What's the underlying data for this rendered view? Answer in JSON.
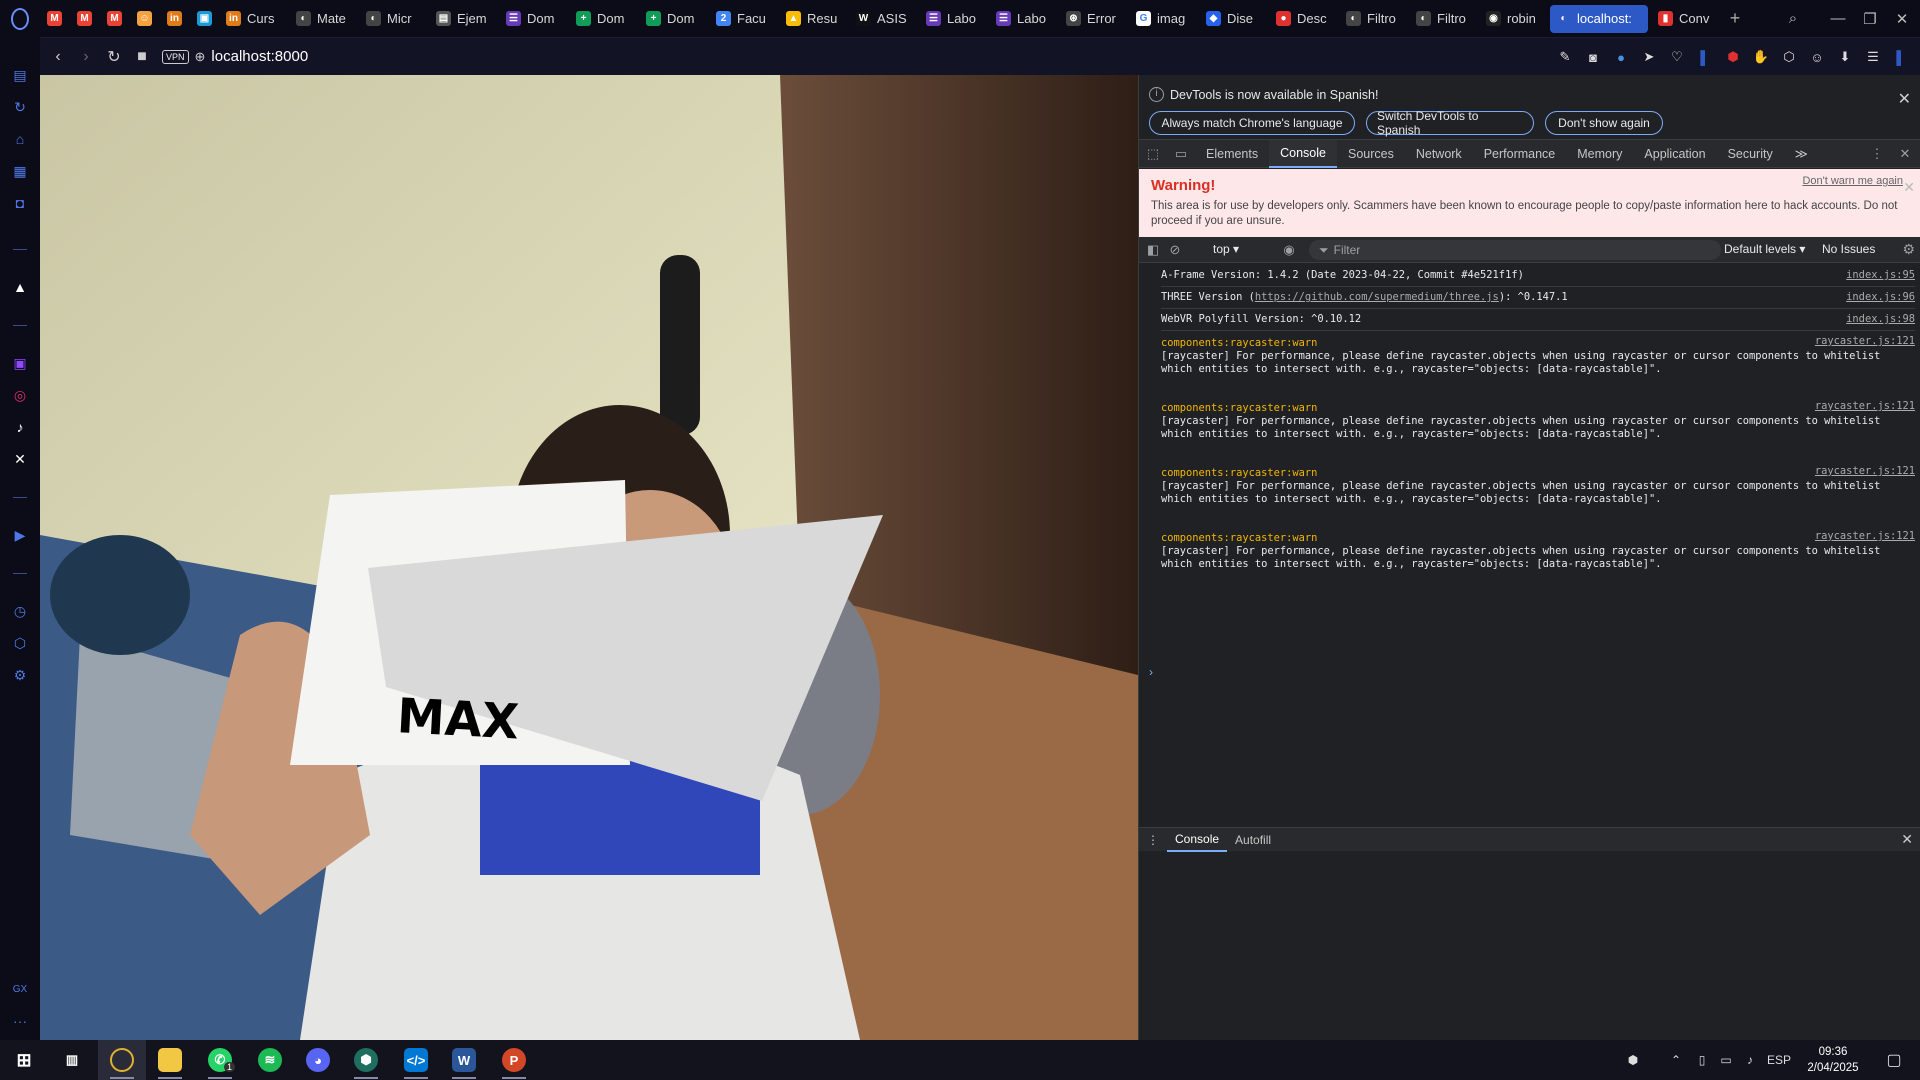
{
  "browser": {
    "tabs": [
      {
        "label": "",
        "icon": "gmail-icon",
        "color": "#ea4335",
        "glyph": "M"
      },
      {
        "label": "",
        "icon": "gmail-icon",
        "color": "#ea4335",
        "glyph": "M"
      },
      {
        "label": "",
        "icon": "gmail-icon",
        "color": "#ea4335",
        "glyph": "M"
      },
      {
        "label": "",
        "icon": "profile-icon",
        "color": "#f4a340",
        "glyph": "☺"
      },
      {
        "label": "",
        "icon": "linkedin-icon",
        "color": "#e07b1a",
        "glyph": "in"
      },
      {
        "label": "",
        "icon": "contacts-icon",
        "color": "#1a9ad6",
        "glyph": "▣"
      },
      {
        "label": "Curs",
        "icon": "linkedin-icon",
        "color": "#e07b1a",
        "glyph": "in"
      },
      {
        "label": "Mate",
        "icon": "globe-icon",
        "color": "#444",
        "glyph": "◐"
      },
      {
        "label": "Micr",
        "icon": "globe-icon",
        "color": "#444",
        "glyph": "◐"
      },
      {
        "label": "Ejem",
        "icon": "document-icon",
        "color": "#555",
        "glyph": "▤"
      },
      {
        "label": "Dom",
        "icon": "forms-icon",
        "color": "#673ab7",
        "glyph": "☰"
      },
      {
        "label": "Dom",
        "icon": "sheets-icon",
        "color": "#0f9d58",
        "glyph": "+"
      },
      {
        "label": "Dom",
        "icon": "sheets-icon",
        "color": "#0f9d58",
        "glyph": "+"
      },
      {
        "label": "Facu",
        "icon": "calendar-icon",
        "color": "#4285f4",
        "glyph": "2"
      },
      {
        "label": "Resu",
        "icon": "drive-icon",
        "color": "#fbbc05",
        "glyph": "▲"
      },
      {
        "label": "ASIS",
        "icon": "wix-icon",
        "color": "#111",
        "glyph": "W"
      },
      {
        "label": "Labo",
        "icon": "forms-icon",
        "color": "#673ab7",
        "glyph": "☰"
      },
      {
        "label": "Labo",
        "icon": "forms-icon",
        "color": "#673ab7",
        "glyph": "☰"
      },
      {
        "label": "Error",
        "icon": "chatgpt-icon",
        "color": "#444",
        "glyph": "⊛"
      },
      {
        "label": "imag",
        "icon": "google-icon",
        "color": "#fff",
        "glyph": "G"
      },
      {
        "label": "Dise",
        "icon": "design-icon",
        "color": "#2563eb",
        "glyph": "◆"
      },
      {
        "label": "Desc",
        "icon": "opera-red-icon",
        "color": "#e03131",
        "glyph": "●"
      },
      {
        "label": "Filtro",
        "icon": "globe-icon",
        "color": "#444",
        "glyph": "◐"
      },
      {
        "label": "Filtro",
        "icon": "globe-icon",
        "color": "#444",
        "glyph": "◐"
      },
      {
        "label": "robin",
        "icon": "github-icon",
        "color": "#222",
        "glyph": "◉"
      },
      {
        "label": "localhost:",
        "icon": "globe-icon",
        "color": "#2d59c6",
        "glyph": "◐",
        "active": true
      },
      {
        "label": "Conv",
        "icon": "pdf-icon",
        "color": "#e03131",
        "glyph": "▮"
      }
    ],
    "url": "localhost:8000",
    "vpn_label": "VPN"
  },
  "scene": {
    "overlay_text": "MAX"
  },
  "devtools": {
    "info_message": "DevTools is now available in Spanish!",
    "info_buttons": [
      "Always match Chrome's language",
      "Switch DevTools to Spanish",
      "Don't show again"
    ],
    "tabs": [
      "Elements",
      "Console",
      "Sources",
      "Network",
      "Performance",
      "Memory",
      "Application",
      "Security"
    ],
    "more_tabs": "≫",
    "warning": {
      "title": "Warning!",
      "dismiss": "Don't warn me again",
      "text": "This area is for use by developers only. Scammers have been known to encourage people to copy/paste information here to hack accounts. Do not proceed if you are unsure."
    },
    "console_toolbar": {
      "context": "top ▾",
      "filter_placeholder": "Filter",
      "levels": "Default levels ▾",
      "issues": "No Issues"
    },
    "logs": [
      {
        "text": "A-Frame Version: 1.4.2 (Date 2023-04-22, Commit #4e521f1f)",
        "source": "index.js:95"
      },
      {
        "text_before": "THREE Version (",
        "link": "https://github.com/supermedium/three.js",
        "text_after": "): ^0.147.1",
        "source": "index.js:96"
      },
      {
        "text": "WebVR Polyfill Version: ^0.10.12",
        "source": "index.js:98"
      }
    ],
    "warnings": [
      {
        "head": "components:raycaster:warn",
        "body": "[raycaster] For performance, please define raycaster.objects when using raycaster or cursor components to whitelist which entities to intersect with. e.g., raycaster=\"objects: [data-raycastable]\".",
        "source": "raycaster.js:121"
      },
      {
        "head": "components:raycaster:warn",
        "body": "[raycaster] For performance, please define raycaster.objects when using raycaster or cursor components to whitelist which entities to intersect with. e.g., raycaster=\"objects: [data-raycastable]\".",
        "source": "raycaster.js:121"
      },
      {
        "head": "components:raycaster:warn",
        "body": "[raycaster] For performance, please define raycaster.objects when using raycaster or cursor components to whitelist which entities to intersect with. e.g., raycaster=\"objects: [data-raycastable]\".",
        "source": "raycaster.js:121"
      },
      {
        "head": "components:raycaster:warn",
        "body": "[raycaster] For performance, please define raycaster.objects when using raycaster or cursor components to whitelist which entities to intersect with. e.g., raycaster=\"objects: [data-raycastable]\".",
        "source": "raycaster.js:121"
      }
    ],
    "prompt": "›",
    "drawer_tabs": [
      "Console",
      "Autofill"
    ]
  },
  "taskbar": {
    "whatsapp_badge": "1",
    "language": "ESP",
    "time": "09:36",
    "date": "2/04/2025"
  },
  "colors": {
    "accent": "#2d59c6",
    "warning_text": "#d93025",
    "console_warn": "#f2b600"
  }
}
